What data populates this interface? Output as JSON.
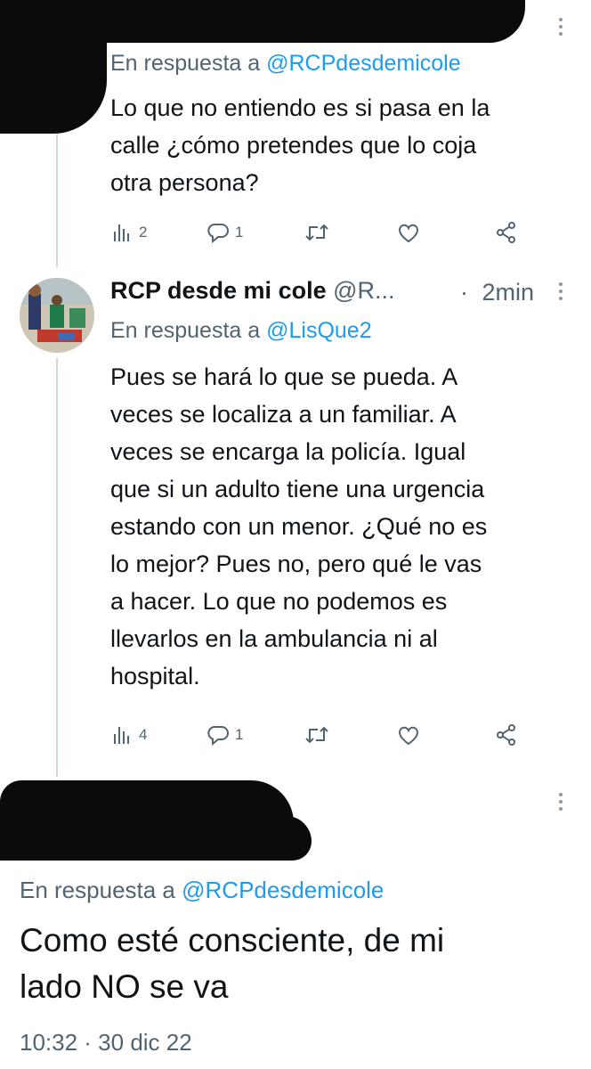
{
  "tweet1": {
    "reply_prefix": "En respuesta a",
    "reply_handle": "@RCPdesdemicole",
    "text_lines": [
      "Lo que no entiendo es si pasa en la",
      "calle ¿cómo pretendes que lo coja",
      "otra persona?"
    ],
    "actions": {
      "views": "2",
      "replies": "1"
    }
  },
  "tweet2": {
    "name": "RCP desde mi cole",
    "handle": "@R...",
    "separator": "·",
    "time": "2min",
    "reply_prefix": "En respuesta a",
    "reply_handle": "@LisQue2",
    "text_lines": [
      "Pues se hará lo que se pueda. A",
      "veces se localiza a un familiar. A",
      "veces se encarga la policía. Igual",
      "que si un adulto tiene una urgencia",
      "estando con un menor. ¿Qué no es",
      "lo mejor? Pues no, pero qué le vas",
      "a hacer. Lo que no podemos es",
      "llevarlos en la ambulancia ni al",
      "hospital."
    ],
    "actions": {
      "views": "4",
      "replies": "1"
    }
  },
  "tweet3": {
    "reply_prefix": "En respuesta a",
    "reply_handle": "@RCPdesdemicole",
    "text_lines": [
      "Como esté consciente, de mi",
      "lado NO se va"
    ],
    "timestamp": "10:32 · 30 dic 22"
  },
  "icons": [
    "views-icon",
    "reply-icon",
    "retweet-icon",
    "like-icon",
    "share-icon",
    "more-icon"
  ],
  "colors": {
    "text": "#0f1419",
    "secondary": "#536471",
    "link": "#1d9bf0",
    "thread_line": "#cfd9de"
  }
}
